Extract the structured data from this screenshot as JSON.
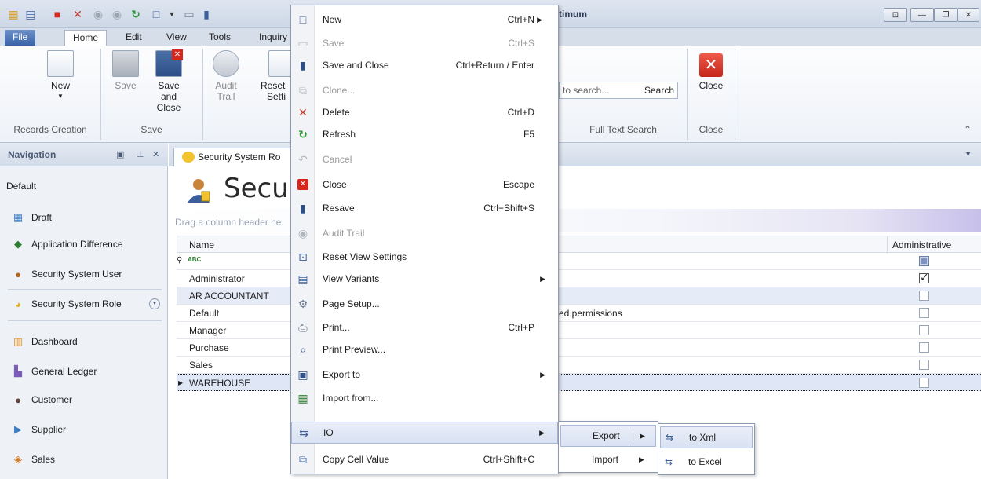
{
  "window": {
    "title": "timum"
  },
  "ribbon_tabs": [
    "File",
    "Home",
    "Edit",
    "View",
    "Tools",
    "Inquiry"
  ],
  "ribbon": {
    "new_label": "New",
    "save_label": "Save",
    "save_close_label_1": "Save and",
    "save_close_label_2": "Close",
    "audit_label_1": "Audit",
    "audit_label_2": "Trail",
    "reset_label_1": "Reset",
    "reset_label_2": "Setti",
    "search_placeholder": "to search...",
    "search_button": "Search",
    "close_label": "Close",
    "groups": {
      "records_creation": "Records Creation",
      "save": "Save",
      "full_text_search": "Full Text Search",
      "close": "Close"
    }
  },
  "navigation": {
    "title": "Navigation",
    "items": [
      "Default",
      "Draft",
      "Application Difference",
      "Security System User",
      "Security System Role",
      "Dashboard",
      "General Ledger",
      "Customer",
      "Supplier",
      "Sales"
    ]
  },
  "document": {
    "tab_label": "Security System Ro",
    "page_title": "Secu",
    "group_hint": "Drag a column header he",
    "columns": {
      "name": "Name",
      "administrative": "Administrative"
    },
    "filter_text": "ABC",
    "rows": [
      {
        "name": "Administrator",
        "desc": "",
        "admin": true
      },
      {
        "name": "AR ACCOUNTANT",
        "desc": "",
        "admin": false
      },
      {
        "name": "Default",
        "desc": "ed permissions",
        "admin": false
      },
      {
        "name": "Manager",
        "desc": "",
        "admin": false
      },
      {
        "name": "Purchase",
        "desc": "",
        "admin": false
      },
      {
        "name": "Sales",
        "desc": "",
        "admin": false
      },
      {
        "name": "WAREHOUSE",
        "desc": "",
        "admin": false
      }
    ]
  },
  "context_menu": {
    "items": [
      {
        "label": "New",
        "shortcut": "Ctrl+N",
        "disabled": false,
        "arrow": true
      },
      {
        "label": "Save",
        "shortcut": "Ctrl+S",
        "disabled": true
      },
      {
        "label": "Save and Close",
        "shortcut": "Ctrl+Return / Enter",
        "disabled": false
      },
      {
        "label": "Clone...",
        "shortcut": "",
        "disabled": true
      },
      {
        "label": "Delete",
        "shortcut": "Ctrl+D",
        "disabled": false
      },
      {
        "label": "Refresh",
        "shortcut": "F5",
        "disabled": false
      },
      {
        "label": "Cancel",
        "shortcut": "",
        "disabled": true
      },
      {
        "label": "Close",
        "shortcut": "Escape",
        "disabled": false
      },
      {
        "label": "Resave",
        "shortcut": "Ctrl+Shift+S",
        "disabled": false
      },
      {
        "label": "Audit Trail",
        "shortcut": "",
        "disabled": true
      },
      {
        "label": "Reset View Settings",
        "shortcut": "",
        "disabled": false
      },
      {
        "label": "View Variants",
        "shortcut": "",
        "disabled": false,
        "arrow": true
      },
      {
        "label": "Page Setup...",
        "shortcut": "",
        "disabled": false
      },
      {
        "label": "Print...",
        "shortcut": "Ctrl+P",
        "disabled": false
      },
      {
        "label": "Print Preview...",
        "shortcut": "",
        "disabled": false
      },
      {
        "label": "Export to",
        "shortcut": "",
        "disabled": false,
        "arrow": true
      },
      {
        "label": "Import from...",
        "shortcut": "",
        "disabled": false
      },
      {
        "label": "IO",
        "shortcut": "",
        "disabled": false,
        "arrow": true
      },
      {
        "label": "Copy Cell Value",
        "shortcut": "Ctrl+Shift+C",
        "disabled": false
      }
    ]
  },
  "io_submenu": {
    "export": "Export",
    "import": "Import"
  },
  "export_submenu": {
    "to_xml": "to Xml",
    "to_excel": "to Excel"
  }
}
